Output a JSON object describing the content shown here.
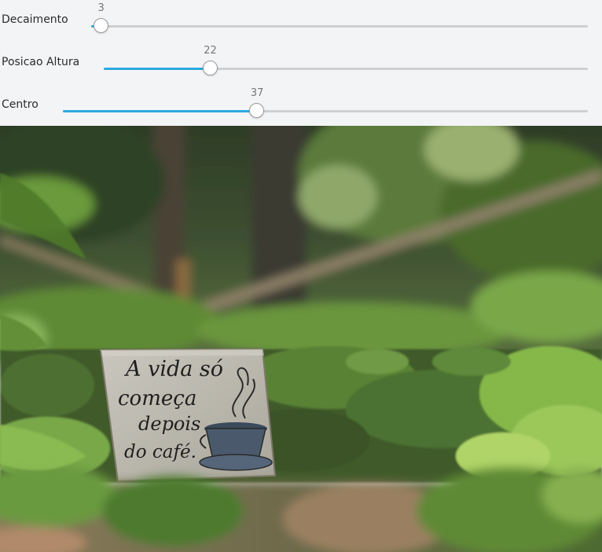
{
  "sliders": [
    {
      "name": "decaimento",
      "label": "Decaimento",
      "value": "3",
      "fraction": 0.02
    },
    {
      "name": "posicao-altura",
      "label": "Posicao Altura",
      "value": "22",
      "fraction": 0.22
    },
    {
      "name": "centro",
      "label": "Centro",
      "value": "37",
      "fraction": 0.37
    }
  ],
  "photo": {
    "sign_text": [
      "A vida só",
      "começa",
      "depois",
      "do café."
    ]
  },
  "colors": {
    "accent": "#2ba9e1",
    "track": "#cfcfcf",
    "panel_bg": "#f3f4f6"
  }
}
